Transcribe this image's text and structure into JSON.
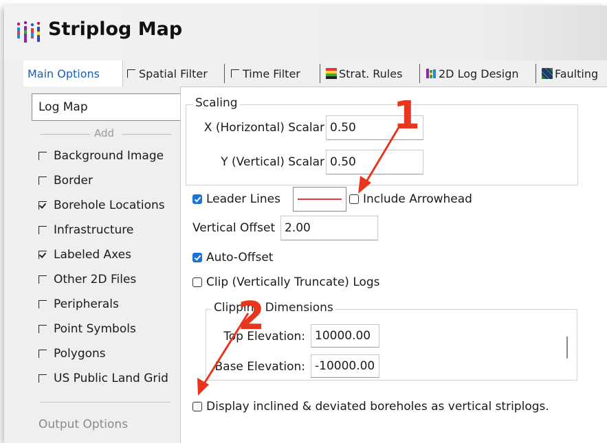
{
  "window": {
    "title": "Striplog Map"
  },
  "tabs": [
    {
      "label": "Main Options",
      "icon": "none"
    },
    {
      "label": "Spatial Filter",
      "icon": "checkbox"
    },
    {
      "label": "Time Filter",
      "icon": "checkbox"
    },
    {
      "label": "Strat. Rules",
      "icon": "strat-rules-icon"
    },
    {
      "label": "2D Log Design",
      "icon": "log-design-icon"
    },
    {
      "label": "Faulting",
      "icon": "faulting-icon"
    }
  ],
  "sidebar": {
    "selected": "Log Map",
    "add_label": "Add",
    "items": [
      {
        "label": "Background Image",
        "checked": false
      },
      {
        "label": "Border",
        "checked": false
      },
      {
        "label": "Borehole Locations",
        "checked": true
      },
      {
        "label": "Infrastructure",
        "checked": false
      },
      {
        "label": "Labeled Axes",
        "checked": true
      },
      {
        "label": "Other 2D Files",
        "checked": false
      },
      {
        "label": "Peripherals",
        "checked": false
      },
      {
        "label": "Point Symbols",
        "checked": false
      },
      {
        "label": "Polygons",
        "checked": false
      },
      {
        "label": "US Public Land Grid",
        "checked": false
      }
    ],
    "output_options": "Output Options"
  },
  "scaling": {
    "legend": "Scaling",
    "x_label": "X (Horizontal) Scalar",
    "x_value": "0.50",
    "y_label": "Y (Vertical) Scalar",
    "y_value": "0.50"
  },
  "leader": {
    "label": "Leader Lines",
    "checked": true,
    "line_color": "#e53935",
    "arrowhead_label": "Include Arrowhead",
    "arrowhead_checked": false
  },
  "offset": {
    "label": "Vertical Offset",
    "value": "2.00"
  },
  "auto_offset": {
    "label": "Auto-Offset",
    "checked": true
  },
  "clip": {
    "label": "Clip (Vertically Truncate) Logs",
    "checked": false
  },
  "clipping": {
    "legend": "Clipping Dimensions",
    "top_label": "Top Elevation:",
    "top_value": "10000.00",
    "base_label": "Base Elevation:",
    "base_value": "-10000.00"
  },
  "display_inclined": {
    "label": "Display inclined & deviated boreholes as vertical striplogs.",
    "checked": false
  },
  "annotations": {
    "one": "1",
    "two": "2",
    "color": "#e8351e"
  },
  "colors": {
    "accent": "#1a73d9",
    "tab_active": "#1a5fb4"
  }
}
